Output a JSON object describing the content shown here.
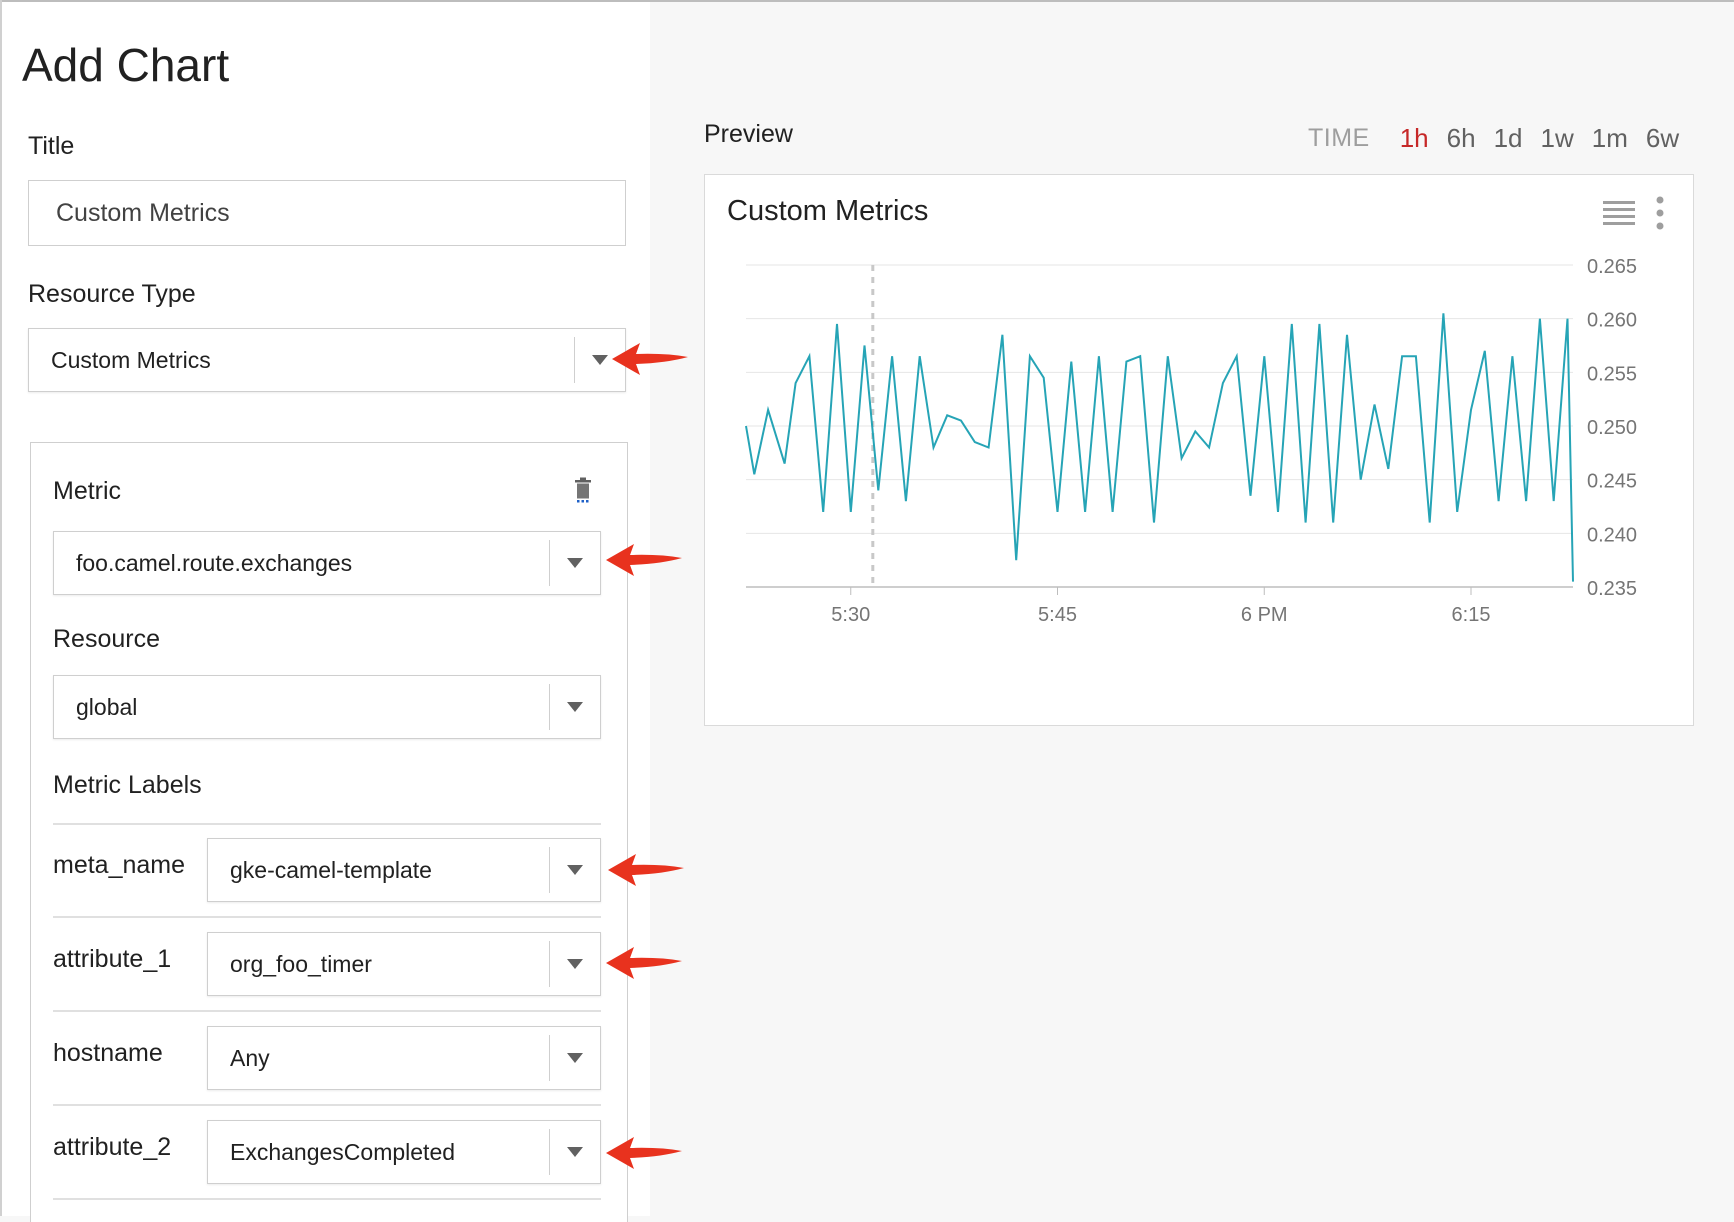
{
  "form": {
    "heading": "Add Chart",
    "title_label": "Title",
    "title_value": "Custom Metrics",
    "resource_type_label": "Resource Type",
    "resource_type_value": "Custom Metrics"
  },
  "metric_card": {
    "metric_label": "Metric",
    "metric_value": "foo.camel.route.exchanges",
    "resource_label": "Resource",
    "resource_value": "global",
    "metric_labels_heading": "Metric Labels",
    "labels": [
      {
        "name": "meta_name",
        "value": "gke-camel-template"
      },
      {
        "name": "attribute_1",
        "value": "org_foo_timer"
      },
      {
        "name": "hostname",
        "value": "Any"
      },
      {
        "name": "attribute_2",
        "value": "ExchangesCompleted"
      }
    ]
  },
  "preview": {
    "label": "Preview",
    "time_caption": "TIME",
    "ranges": [
      "1h",
      "6h",
      "1d",
      "1w",
      "1m",
      "6w"
    ],
    "active_range": "1h",
    "chart_title": "Custom Metrics"
  },
  "icons": {
    "delete": "trash-icon",
    "legend": "legend-list-icon",
    "menu": "more-vert-icon",
    "annotation": "red-arrow-icon"
  },
  "colors": {
    "line": "#26a4b6",
    "active_range": "#c62828",
    "arrow": "#e8321e"
  },
  "chart_data": {
    "type": "line",
    "title": "Custom Metrics",
    "xlabel": "",
    "ylabel": "",
    "x_tick_labels": [
      "5:30",
      "5:45",
      "6 PM",
      "6:15"
    ],
    "x_tick_minutes": [
      30,
      45,
      60,
      75
    ],
    "xlim_minutes": [
      22.4,
      82.4
    ],
    "ylim": [
      0.235,
      0.265
    ],
    "y_ticks": [
      0.265,
      0.26,
      0.255,
      0.25,
      0.245,
      0.24,
      0.235
    ],
    "y_axis_position": "right",
    "grid": true,
    "marker_minute": 31.6,
    "series": [
      {
        "values": [
          [
            22.4,
            0.25
          ],
          [
            23.0,
            0.2455
          ],
          [
            24.0,
            0.2515
          ],
          [
            25.2,
            0.2465
          ],
          [
            26.0,
            0.254
          ],
          [
            27.0,
            0.2565
          ],
          [
            28.0,
            0.242
          ],
          [
            29.0,
            0.2595
          ],
          [
            30.0,
            0.242
          ],
          [
            31.0,
            0.2575
          ],
          [
            32.0,
            0.244
          ],
          [
            33.0,
            0.2565
          ],
          [
            34.0,
            0.243
          ],
          [
            35.0,
            0.2565
          ],
          [
            36.0,
            0.248
          ],
          [
            37.0,
            0.251
          ],
          [
            38.0,
            0.2505
          ],
          [
            39.0,
            0.2485
          ],
          [
            40.0,
            0.248
          ],
          [
            41.0,
            0.2585
          ],
          [
            42.0,
            0.2375
          ],
          [
            43.0,
            0.2565
          ],
          [
            44.0,
            0.2545
          ],
          [
            45.0,
            0.242
          ],
          [
            46.0,
            0.256
          ],
          [
            47.0,
            0.242
          ],
          [
            48.0,
            0.2565
          ],
          [
            49.0,
            0.242
          ],
          [
            50.0,
            0.256
          ],
          [
            51.0,
            0.2565
          ],
          [
            52.0,
            0.241
          ],
          [
            53.0,
            0.2565
          ],
          [
            54.0,
            0.247
          ],
          [
            55.0,
            0.2495
          ],
          [
            56.0,
            0.248
          ],
          [
            57.0,
            0.254
          ],
          [
            58.0,
            0.2565
          ],
          [
            59.0,
            0.2435
          ],
          [
            60.0,
            0.2565
          ],
          [
            61.0,
            0.242
          ],
          [
            62.0,
            0.2595
          ],
          [
            63.0,
            0.241
          ],
          [
            64.0,
            0.2595
          ],
          [
            65.0,
            0.241
          ],
          [
            66.0,
            0.2585
          ],
          [
            67.0,
            0.245
          ],
          [
            68.0,
            0.252
          ],
          [
            69.0,
            0.246
          ],
          [
            70.0,
            0.2565
          ],
          [
            71.0,
            0.2565
          ],
          [
            72.0,
            0.241
          ],
          [
            73.0,
            0.2605
          ],
          [
            74.0,
            0.242
          ],
          [
            75.0,
            0.2515
          ],
          [
            76.0,
            0.257
          ],
          [
            77.0,
            0.243
          ],
          [
            78.0,
            0.2565
          ],
          [
            79.0,
            0.243
          ],
          [
            80.0,
            0.26
          ],
          [
            81.0,
            0.243
          ],
          [
            82.0,
            0.26
          ],
          [
            82.4,
            0.2355
          ]
        ]
      }
    ]
  }
}
